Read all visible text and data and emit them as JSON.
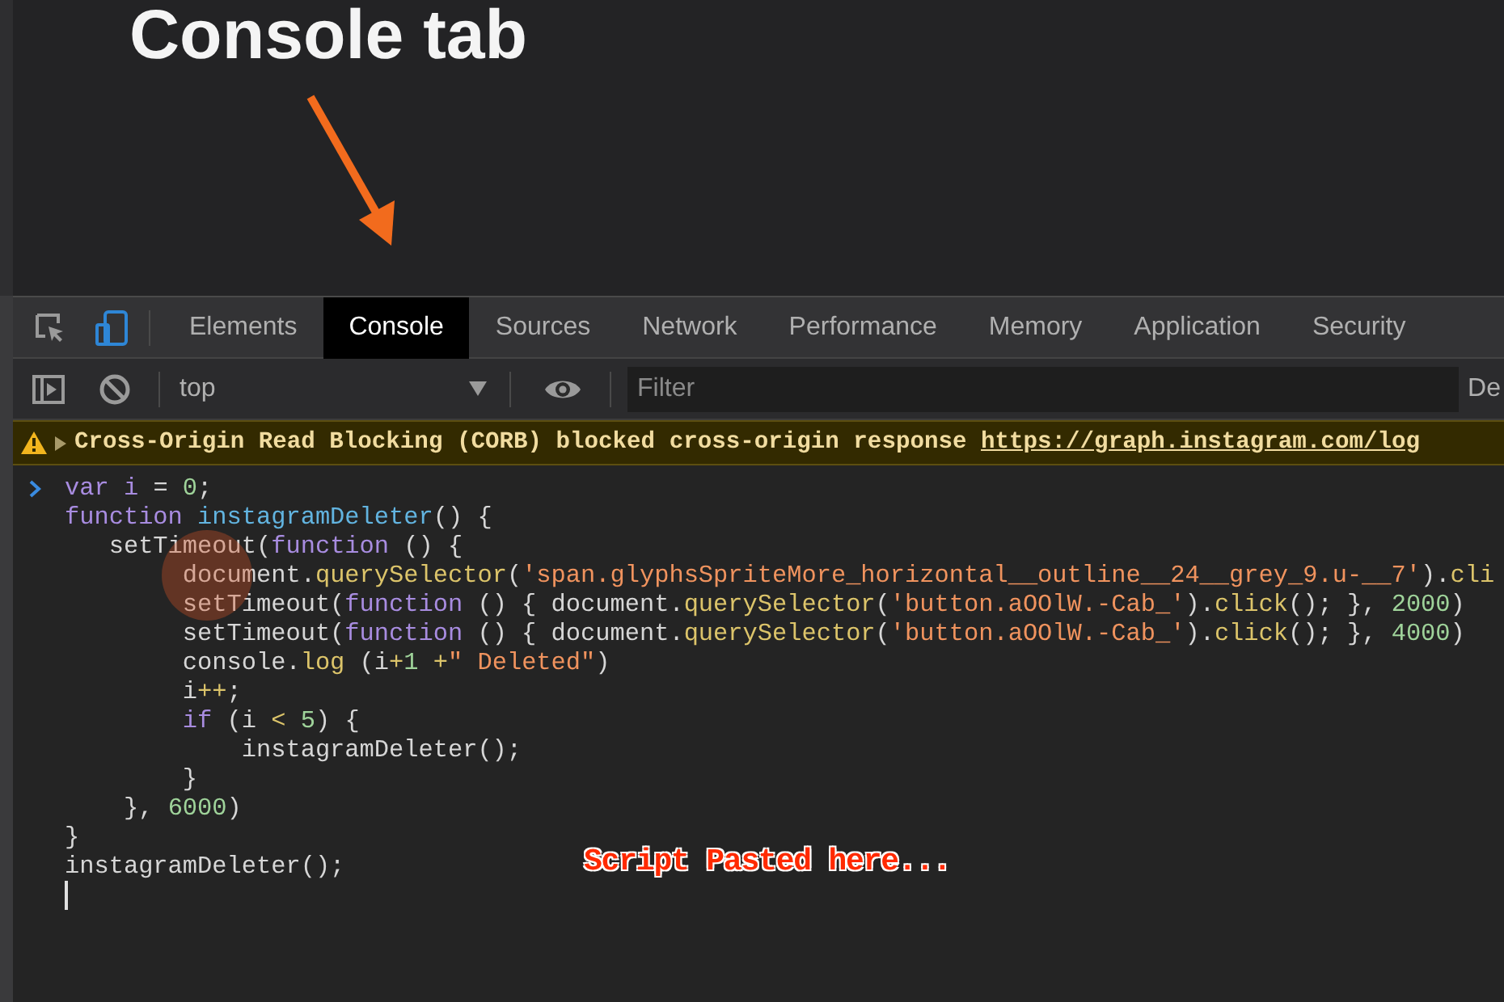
{
  "annotation": {
    "title": "Console tab",
    "caption": "Script Pasted here..."
  },
  "tabs": [
    {
      "label": "Elements",
      "selected": false
    },
    {
      "label": "Console",
      "selected": true
    },
    {
      "label": "Sources",
      "selected": false
    },
    {
      "label": "Network",
      "selected": false
    },
    {
      "label": "Performance",
      "selected": false
    },
    {
      "label": "Memory",
      "selected": false
    },
    {
      "label": "Application",
      "selected": false
    },
    {
      "label": "Security",
      "selected": false
    }
  ],
  "toolbar": {
    "context": "top",
    "filter_placeholder": "Filter",
    "levels": "De"
  },
  "warning": {
    "message": "Cross-Origin Read Blocking (CORB) blocked cross-origin response ",
    "link": "https://graph.instagram.com/log"
  },
  "console_lines": [
    {
      "prompt": true,
      "tokens": [
        {
          "kind": "kw",
          "text": "var i"
        },
        {
          "kind": "plain",
          "text": " = "
        },
        {
          "kind": "num",
          "text": "0"
        },
        {
          "kind": "plain",
          "text": ";"
        }
      ]
    },
    {
      "prompt": false,
      "tokens": [
        {
          "kind": "kw",
          "text": "function"
        },
        {
          "kind": "def",
          "text": " instagramDeleter"
        },
        {
          "kind": "plain",
          "text": "() {"
        }
      ]
    },
    {
      "prompt": false,
      "tokens": [
        {
          "kind": "plain",
          "text": "   setTimeout("
        },
        {
          "kind": "kw",
          "text": "function"
        },
        {
          "kind": "plain",
          "text": " () {"
        }
      ]
    },
    {
      "prompt": false,
      "tokens": [
        {
          "kind": "plain",
          "text": "        document."
        },
        {
          "kind": "method",
          "text": "querySelector"
        },
        {
          "kind": "plain",
          "text": "("
        },
        {
          "kind": "str",
          "text": "'span.glyphsSpriteMore_horizontal__outline__24__grey_9.u-__7'"
        },
        {
          "kind": "plain",
          "text": ")."
        },
        {
          "kind": "method",
          "text": "cli"
        }
      ]
    },
    {
      "prompt": false,
      "tokens": [
        {
          "kind": "plain",
          "text": "        setTimeout("
        },
        {
          "kind": "kw",
          "text": "function"
        },
        {
          "kind": "plain",
          "text": " () { document."
        },
        {
          "kind": "method",
          "text": "querySelector"
        },
        {
          "kind": "plain",
          "text": "("
        },
        {
          "kind": "str",
          "text": "'button.aOOlW.-Cab_'"
        },
        {
          "kind": "plain",
          "text": ")."
        },
        {
          "kind": "method",
          "text": "click"
        },
        {
          "kind": "plain",
          "text": "(); }, "
        },
        {
          "kind": "num",
          "text": "2000"
        },
        {
          "kind": "plain",
          "text": ")"
        }
      ]
    },
    {
      "prompt": false,
      "tokens": [
        {
          "kind": "plain",
          "text": "        setTimeout("
        },
        {
          "kind": "kw",
          "text": "function"
        },
        {
          "kind": "plain",
          "text": " () { document."
        },
        {
          "kind": "method",
          "text": "querySelector"
        },
        {
          "kind": "plain",
          "text": "("
        },
        {
          "kind": "str",
          "text": "'button.aOOlW.-Cab_'"
        },
        {
          "kind": "plain",
          "text": ")."
        },
        {
          "kind": "method",
          "text": "click"
        },
        {
          "kind": "plain",
          "text": "(); }, "
        },
        {
          "kind": "num",
          "text": "4000"
        },
        {
          "kind": "plain",
          "text": ")"
        }
      ]
    },
    {
      "prompt": false,
      "tokens": [
        {
          "kind": "plain",
          "text": "        console."
        },
        {
          "kind": "method",
          "text": "log"
        },
        {
          "kind": "plain",
          "text": " (i"
        },
        {
          "kind": "method",
          "text": "+"
        },
        {
          "kind": "num",
          "text": "1"
        },
        {
          "kind": "method",
          "text": " +"
        },
        {
          "kind": "str",
          "text": "\" Deleted\""
        },
        {
          "kind": "plain",
          "text": ")"
        }
      ]
    },
    {
      "prompt": false,
      "tokens": [
        {
          "kind": "plain",
          "text": "        i"
        },
        {
          "kind": "method",
          "text": "++"
        },
        {
          "kind": "plain",
          "text": ";"
        }
      ]
    },
    {
      "prompt": false,
      "tokens": [
        {
          "kind": "kw",
          "text": "        if"
        },
        {
          "kind": "plain",
          "text": " (i "
        },
        {
          "kind": "method",
          "text": "<"
        },
        {
          "kind": "num",
          "text": " 5"
        },
        {
          "kind": "plain",
          "text": ") {"
        }
      ]
    },
    {
      "prompt": false,
      "tokens": [
        {
          "kind": "plain",
          "text": "            instagramDeleter();"
        }
      ]
    },
    {
      "prompt": false,
      "tokens": [
        {
          "kind": "plain",
          "text": "        }"
        }
      ]
    },
    {
      "prompt": false,
      "tokens": [
        {
          "kind": "plain",
          "text": "    }, "
        },
        {
          "kind": "num",
          "text": "6000"
        },
        {
          "kind": "plain",
          "text": ")"
        }
      ]
    },
    {
      "prompt": false,
      "tokens": [
        {
          "kind": "plain",
          "text": "}"
        }
      ]
    },
    {
      "prompt": false,
      "tokens": [
        {
          "kind": "plain",
          "text": "instagramDeleter();"
        }
      ]
    }
  ]
}
